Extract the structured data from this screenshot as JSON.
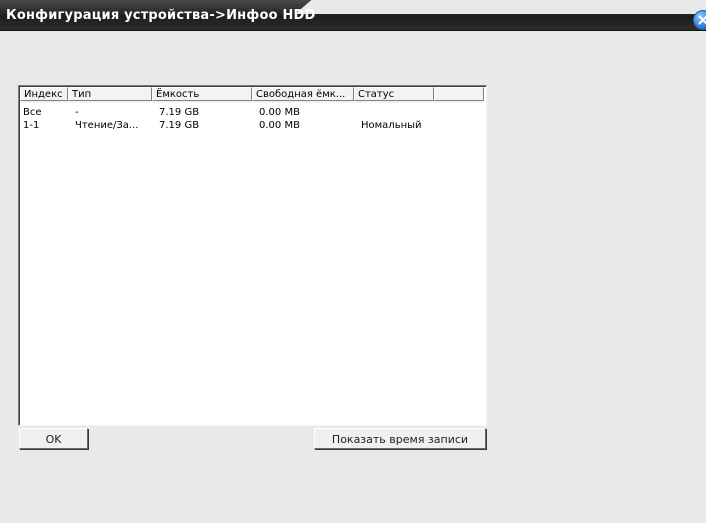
{
  "window": {
    "title": "Конфигурация устройства->Инфоо HDD",
    "close_icon": "close-icon"
  },
  "table": {
    "columns": [
      "Индекс",
      "Тип",
      "Ёмкость",
      "Свободная ёмк...",
      "Статус",
      ""
    ],
    "rows": [
      [
        "Все",
        "-",
        "7.19 GB",
        "0.00 MB",
        ""
      ],
      [
        "1-1",
        "Чтение/За...",
        "7.19 GB",
        "0.00 MB",
        "Номальный"
      ]
    ]
  },
  "buttons": {
    "ok": "OK",
    "show_record_time": "Показать время записи"
  }
}
